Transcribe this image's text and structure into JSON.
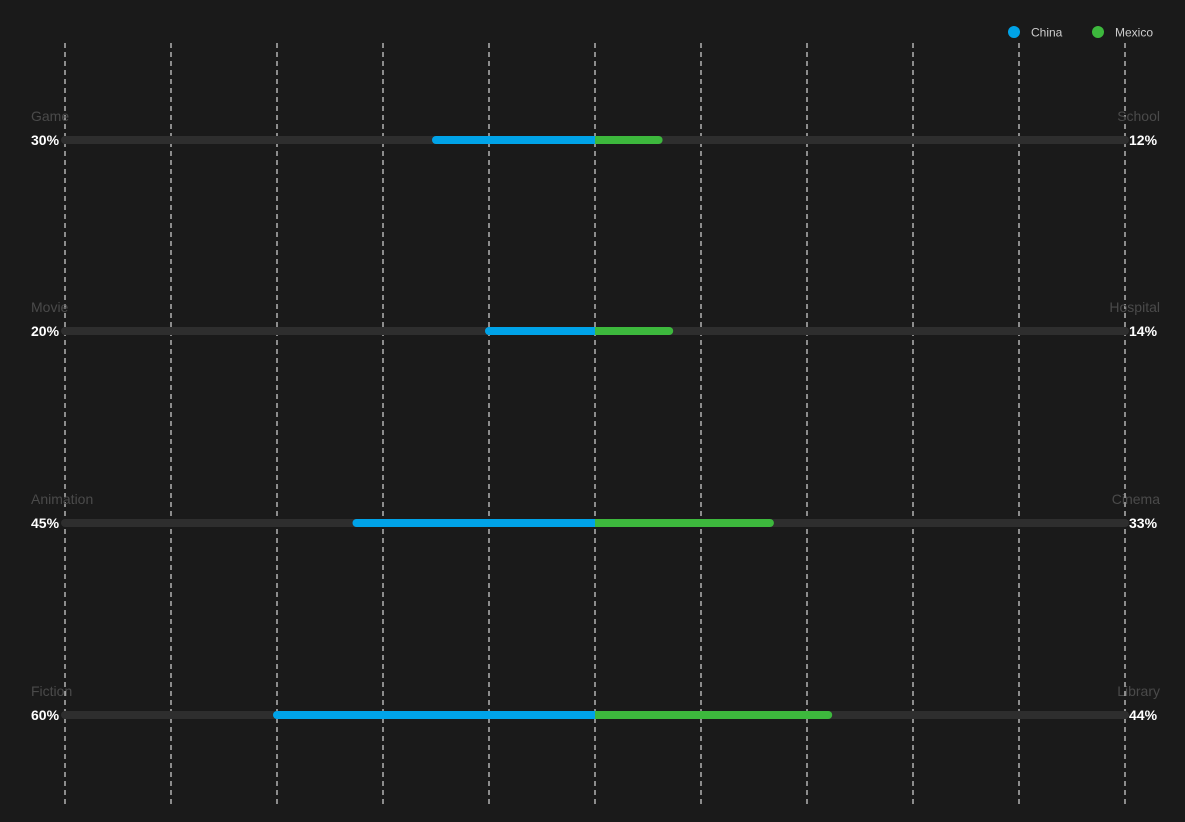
{
  "chart_data": {
    "type": "bar",
    "orientation": "diverging-horizontal",
    "xlim": [
      -100,
      100
    ],
    "grid": "vertical-dashed",
    "legend_position": "top-right",
    "series": [
      {
        "name": "China",
        "color": "#00a3e8",
        "direction": "left",
        "categories": [
          "Game",
          "Movie",
          "Animation",
          "Fiction"
        ],
        "values": [
          30,
          20,
          45,
          60
        ],
        "labels": [
          "30%",
          "20%",
          "45%",
          "60%"
        ]
      },
      {
        "name": "Mexico",
        "color": "#3db83d",
        "direction": "right",
        "categories": [
          "School",
          "Hospital",
          "Cinema",
          "Library"
        ],
        "values": [
          12,
          14,
          33,
          44
        ],
        "labels": [
          "12%",
          "14%",
          "33%",
          "44%"
        ]
      }
    ],
    "track_color": "#2e2e2e",
    "grid_color": "#ffffff"
  }
}
